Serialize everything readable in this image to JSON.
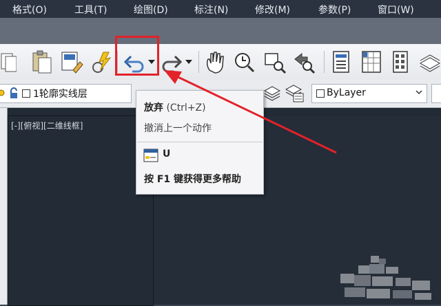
{
  "menu": {
    "items": [
      "格式(O)",
      "工具(T)",
      "绘图(D)",
      "标注(N)",
      "修改(M)",
      "参数(P)",
      "窗口(W)"
    ]
  },
  "toolbar": {
    "icons": [
      "copy-icon",
      "paste-icon",
      "match-properties-icon",
      "block-editor-icon",
      "undo-icon",
      "redo-icon",
      "pan-icon",
      "zoom-realtime-icon",
      "zoom-window-icon",
      "zoom-previous-icon",
      "properties-icon",
      "design-center-icon",
      "tool-palettes-icon",
      "sheet-set-icon"
    ]
  },
  "layer": {
    "name": "1轮廓实线层"
  },
  "properties": {
    "color_value": "ByLayer"
  },
  "viewport": {
    "label": "[-][俯视][二维线框]"
  },
  "tooltip": {
    "title": "放弃",
    "shortcut": "(Ctrl+Z)",
    "description": "撤消上一个动作",
    "command": "U",
    "help": "按 F1 键获得更多帮助"
  },
  "colors": {
    "highlight": "#e3222a",
    "menubar": "#2b3340",
    "drawing_bg": "#222a35"
  }
}
